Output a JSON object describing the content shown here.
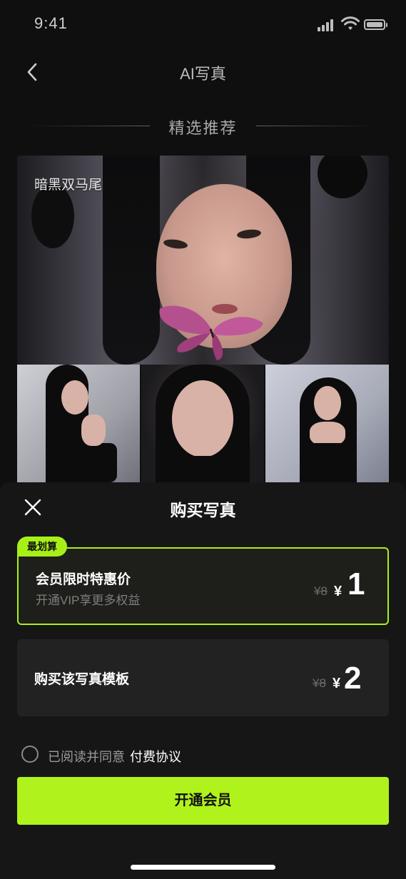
{
  "status_bar": {
    "time": "9:41"
  },
  "header": {
    "title": "AI写真"
  },
  "section": {
    "title": "精选推荐"
  },
  "template": {
    "name": "暗黑双马尾"
  },
  "sheet": {
    "title": "购买写真",
    "options": [
      {
        "badge": "最划算",
        "title": "会员限时特惠价",
        "subtitle": "开通VIP享更多权益",
        "original_price": "¥8",
        "currency": "¥",
        "price": "1",
        "selected": true
      },
      {
        "title": "购买该写真模板",
        "original_price": "¥8",
        "currency": "¥",
        "price": "2",
        "selected": false
      }
    ],
    "agreement": {
      "text": "已阅读并同意",
      "link": "付费协议",
      "checked": false
    },
    "cta": "开通会员"
  },
  "colors": {
    "accent": "#b0f21c",
    "background": "#0f0f10",
    "sheet": "#161617"
  }
}
